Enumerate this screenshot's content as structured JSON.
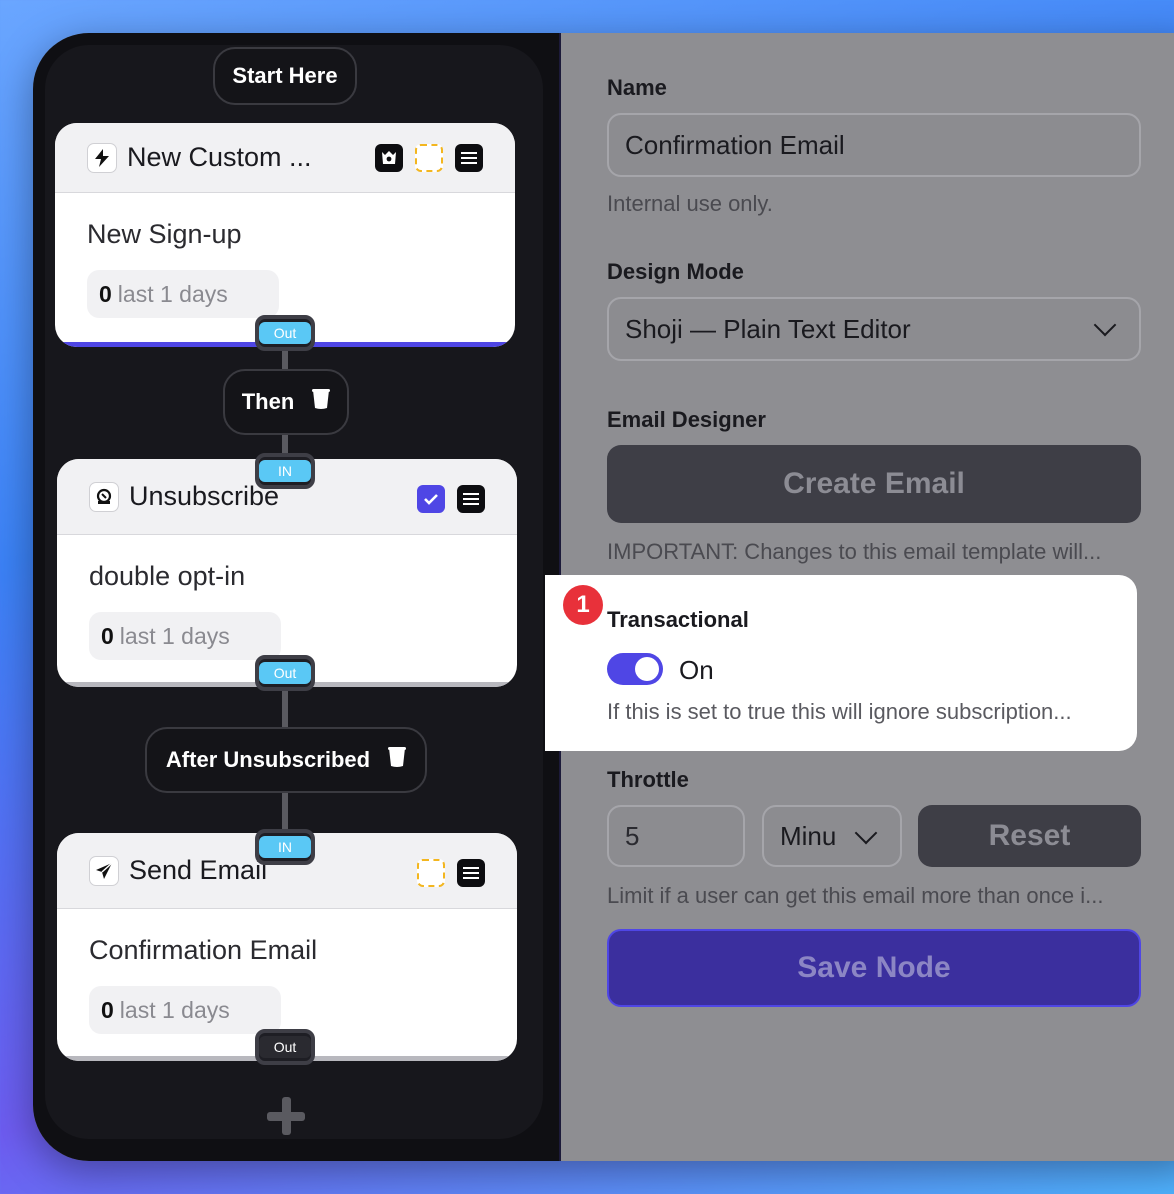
{
  "flow": {
    "start_label": "Start Here",
    "nodes": [
      {
        "title": "New Custom ...",
        "icon": "lightning-icon",
        "name": "New Sign-up",
        "stat_value": "0",
        "stat_text": "last 1 days",
        "out_label": "Out"
      },
      {
        "title": "Unsubscribe",
        "icon": "unsubscribe-icon",
        "in_label": "IN",
        "name": "double opt-in",
        "stat_value": "0",
        "stat_text": "last 1 days",
        "out_label": "Out"
      },
      {
        "title": "Send Email",
        "icon": "paper-plane-icon",
        "in_label": "IN",
        "name": "Confirmation Email",
        "stat_value": "0",
        "stat_text": "last 1 days",
        "out_label": "Out"
      }
    ],
    "connectors": [
      {
        "label": "Then"
      },
      {
        "label": "After Unsubscribed"
      }
    ]
  },
  "settings": {
    "name_label": "Name",
    "name_value": "Confirmation Email",
    "name_help": "Internal use only.",
    "design_mode_label": "Design Mode",
    "design_mode_value": "Shoji — Plain Text Editor",
    "email_designer_label": "Email Designer",
    "create_email_label": "Create Email",
    "important_text": "IMPORTANT: Changes to this email template will...",
    "badge_number": "1",
    "transactional_label": "Transactional",
    "transactional_state": "On",
    "transactional_help": "If this is set to true this will ignore subscription...",
    "throttle_label": "Throttle",
    "throttle_value": "5",
    "throttle_unit": "Minu",
    "reset_label": "Reset",
    "throttle_help": "Limit if a user can get this email more than once i...",
    "save_label": "Save Node"
  },
  "colors": {
    "accent": "#4f46e5",
    "port_blue": "#5ac8f5",
    "badge_red": "#e8313a",
    "warning_yellow": "#f3b61f"
  }
}
